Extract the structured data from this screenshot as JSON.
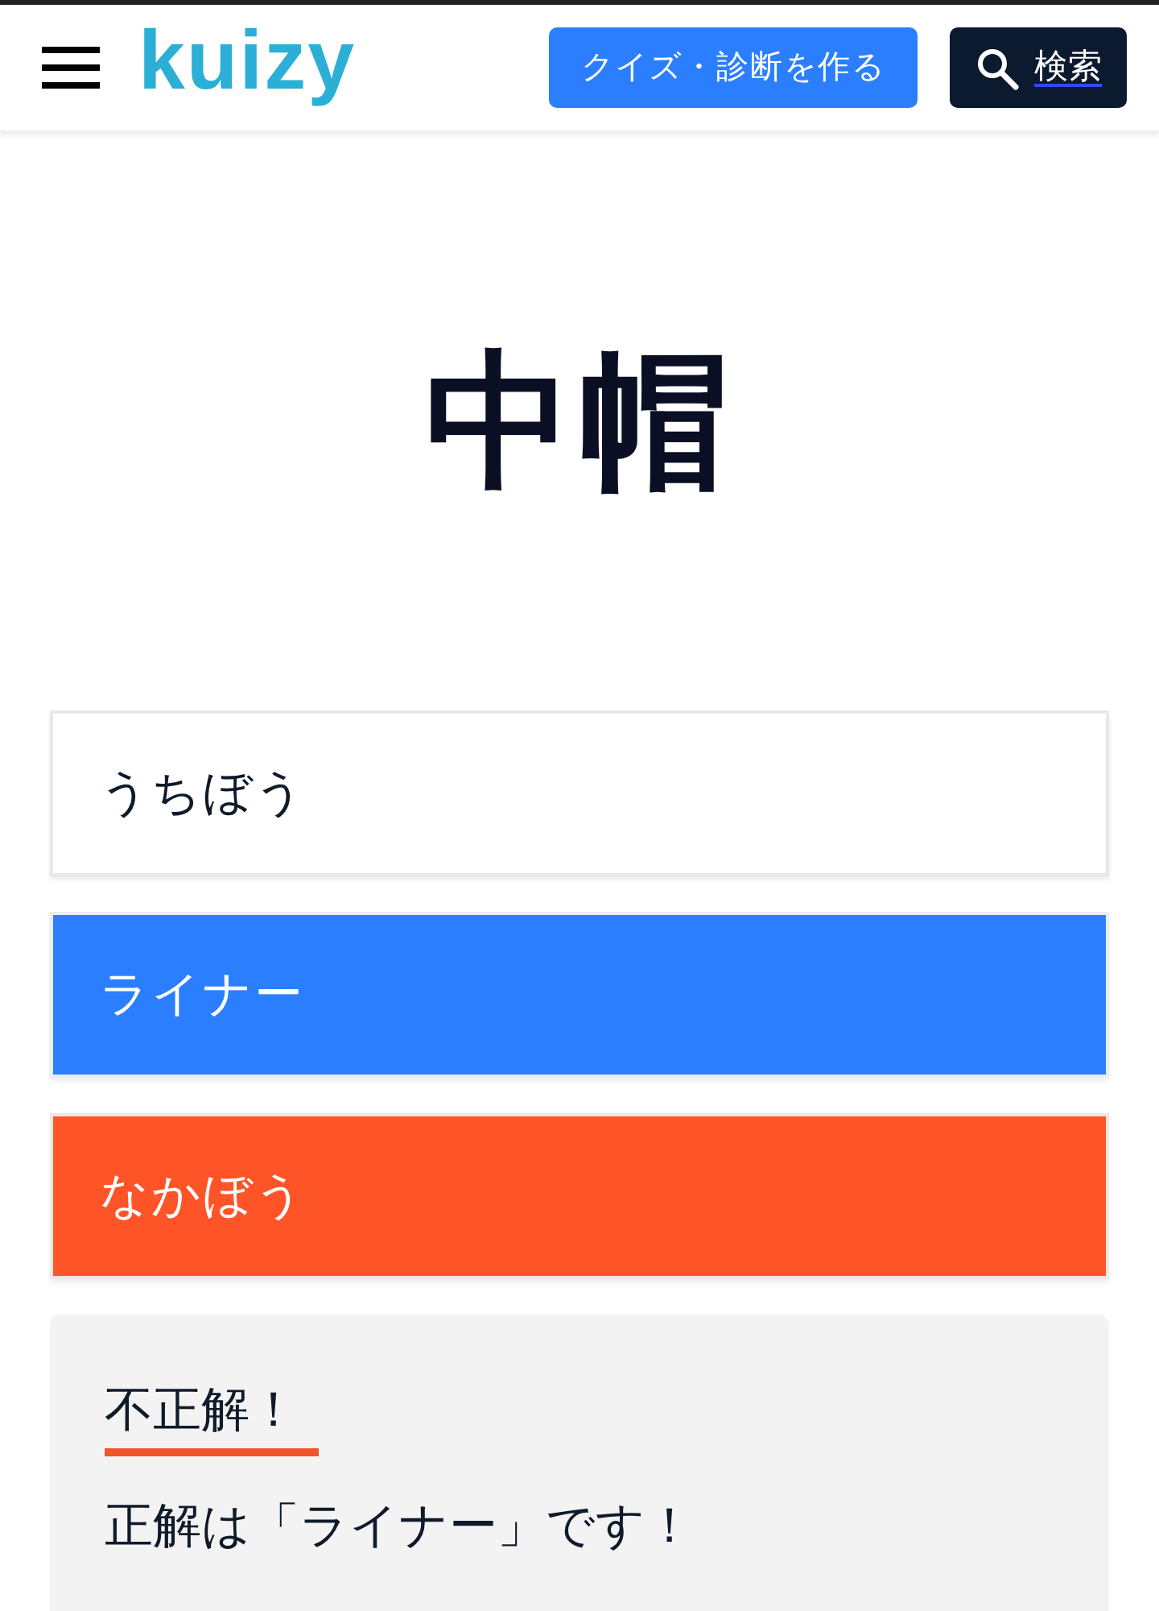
{
  "header": {
    "logo": "kuizy",
    "create_button": "クイズ・診断を作る",
    "search_button": "検索"
  },
  "question": {
    "title": "中帽"
  },
  "choices": [
    {
      "label": "うちぼう",
      "selected": false,
      "correct": false
    },
    {
      "label": "ライナー",
      "selected": false,
      "correct": true
    },
    {
      "label": "なかぼう",
      "selected": true,
      "correct": false
    }
  ],
  "result": {
    "correct": false,
    "verdict": "不正解！",
    "message": "正解は「ライナー」です！"
  }
}
